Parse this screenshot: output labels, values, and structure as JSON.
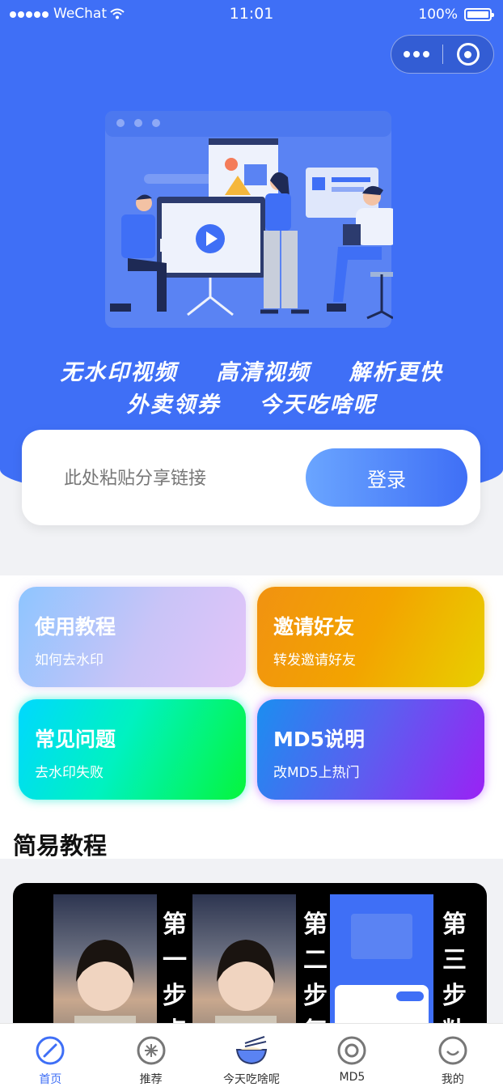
{
  "status_bar": {
    "carrier": "WeChat",
    "time": "11:01",
    "battery": "100%"
  },
  "slogan": {
    "line1": [
      "无水印视频",
      "高清视频",
      "解析更快"
    ],
    "line2": [
      "外卖领券",
      "今天吃啥呢"
    ]
  },
  "search": {
    "placeholder": "此处粘贴分享链接",
    "button_label": "登录"
  },
  "cards": [
    {
      "title": "使用教程",
      "subtitle": "如何去水印"
    },
    {
      "title": "邀请好友",
      "subtitle": "转发邀请好友"
    },
    {
      "title": "常见问题",
      "subtitle": "去水印失败"
    },
    {
      "title": "MD5说明",
      "subtitle": "改MD5上热门"
    }
  ],
  "section": {
    "title": "简易教程"
  },
  "tutorial": {
    "steps": [
      "第一步点",
      "第二步复",
      "第三步粘"
    ]
  },
  "tabbar": {
    "items": [
      {
        "label": "首页",
        "icon": "compass-icon",
        "active": true
      },
      {
        "label": "推荐",
        "icon": "snowflake-icon",
        "active": false
      },
      {
        "label": "今天吃啥呢",
        "icon": "noodle-bowl-icon",
        "active": false
      },
      {
        "label": "MD5",
        "icon": "target-icon",
        "active": false
      },
      {
        "label": "我的",
        "icon": "smile-icon",
        "active": false
      }
    ]
  },
  "colors": {
    "brand": "#3f6ff6",
    "tab_active": "#3f6ff6"
  }
}
